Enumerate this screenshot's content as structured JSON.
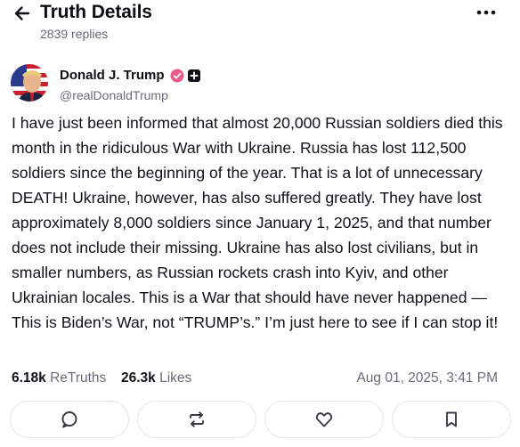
{
  "header": {
    "title": "Truth Details",
    "replies": "2839 replies",
    "back_icon": "arrow-left-icon",
    "more_icon": "more-horizontal-icon"
  },
  "author": {
    "name": "Donald J. Trump",
    "handle": "@realDonaldTrump",
    "verified_color": "#e95a8c"
  },
  "post": {
    "text": "I have just been informed that almost 20,000 Russian soldiers died this month in the ridiculous War with Ukraine. Russia has lost 112,500 soldiers since the beginning of the year. That is a lot of unnecessary DEATH! Ukraine, however, has also suffered greatly. They have lost approximately 8,000 soldiers since January 1, 2025, and that number does not include their missing. Ukraine has also lost civilians, but in smaller numbers, as Russian rockets crash into Kyiv, and other Ukrainian locales. This is a War that should have never happened — This is Biden’s War, not “TRUMP’s.” I’m just here to see if I can stop it!"
  },
  "stats": {
    "retruths_count": "6.18k",
    "retruths_label": "ReTruths",
    "likes_count": "26.3k",
    "likes_label": "Likes",
    "timestamp": "Aug 01, 2025, 3:41 PM"
  },
  "actions": [
    {
      "name": "reply",
      "icon": "comment-icon"
    },
    {
      "name": "retruth",
      "icon": "repost-icon"
    },
    {
      "name": "like",
      "icon": "heart-icon"
    },
    {
      "name": "bookmark",
      "icon": "bookmark-icon"
    }
  ]
}
